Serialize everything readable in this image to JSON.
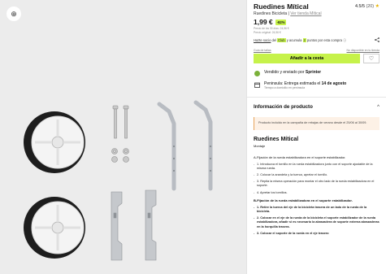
{
  "product": {
    "title": "Ruedines Mítical",
    "rating_value": "4.5/5",
    "rating_count": "(20)",
    "rating_star": "★",
    "brand_line": "Ruedines Bicicleta",
    "brand_sep": " | ",
    "brand_link": "Ver tienda Mítical",
    "price": "1,99 €",
    "discount_badge": "-92%",
    "fineprint_1": "Precio de los 30 días: 24,56 €",
    "fineprint_2": "Precio original: 24,56 €"
  },
  "promo": {
    "prefix": "Hazte socio",
    "middle": " del ",
    "club": "Club",
    "text2": " y acumula ",
    "points": "2",
    "text3": " puntos por esta compra",
    "info_icon": "ⓘ",
    "share_icon": "share-icon"
  },
  "links": {
    "size_guide": "Guía de tallas",
    "not_available": "No disponible en tu tienda"
  },
  "cart": {
    "add_label": "Añadir a la cesta",
    "wishlist_icon": "♡"
  },
  "seller": {
    "text": "Vendido y enviado por ",
    "name": "Sprinter"
  },
  "delivery": {
    "text": "Peninsula: Entrega estimada el ",
    "date": "14 de agosto",
    "note": "Tiempo a domicilio en península"
  },
  "accordion": {
    "title": "Información de producto",
    "chevron": "^"
  },
  "campaign": {
    "text": "Producto incluido en la campaña de rebajas de verano desde el 25/06 al 30/09."
  },
  "description": {
    "title": "Ruedines Mítical",
    "subtitle": "Montaje",
    "section_a": "A-Fijación de la rueda estabilizadora en el soporte estabilizador.",
    "steps_a": [
      "1. Introduzca el tornillo en la rueda estabilizadora junto con el soporte ajustable de la misma rueda.",
      "2. Colocar la arandela y la tuerca, apretar el tornillo.",
      "3. Repita la misma operación para montar el otro lado de la rueda estabilizadora en el soporte.",
      "4. Apretar los tornillos."
    ],
    "section_b": "B-Fijación de la rueda estabilizadora en el soporte estabilizador.",
    "steps_b": [
      "1. Retire la tuerca del eje de la bicicleta trasera de un lado de la rueda de la bicicleta.",
      "2. Colocar en el eje de la rueda de la bicicleta el soporte estabilizador de la rueda estabilizadora, añadir si es necesario la abrazadera de soporte externa abrazaderas en la horquilla trasera.",
      "3. Colocar el soporte de la rueda en el eje trasero"
    ]
  },
  "gallery": {
    "zoom_icon": "⊕"
  },
  "colors": {
    "accent": "#c6f24a",
    "campaign_bg": "#fdf1e6",
    "gallery_bg": "#ececec"
  }
}
